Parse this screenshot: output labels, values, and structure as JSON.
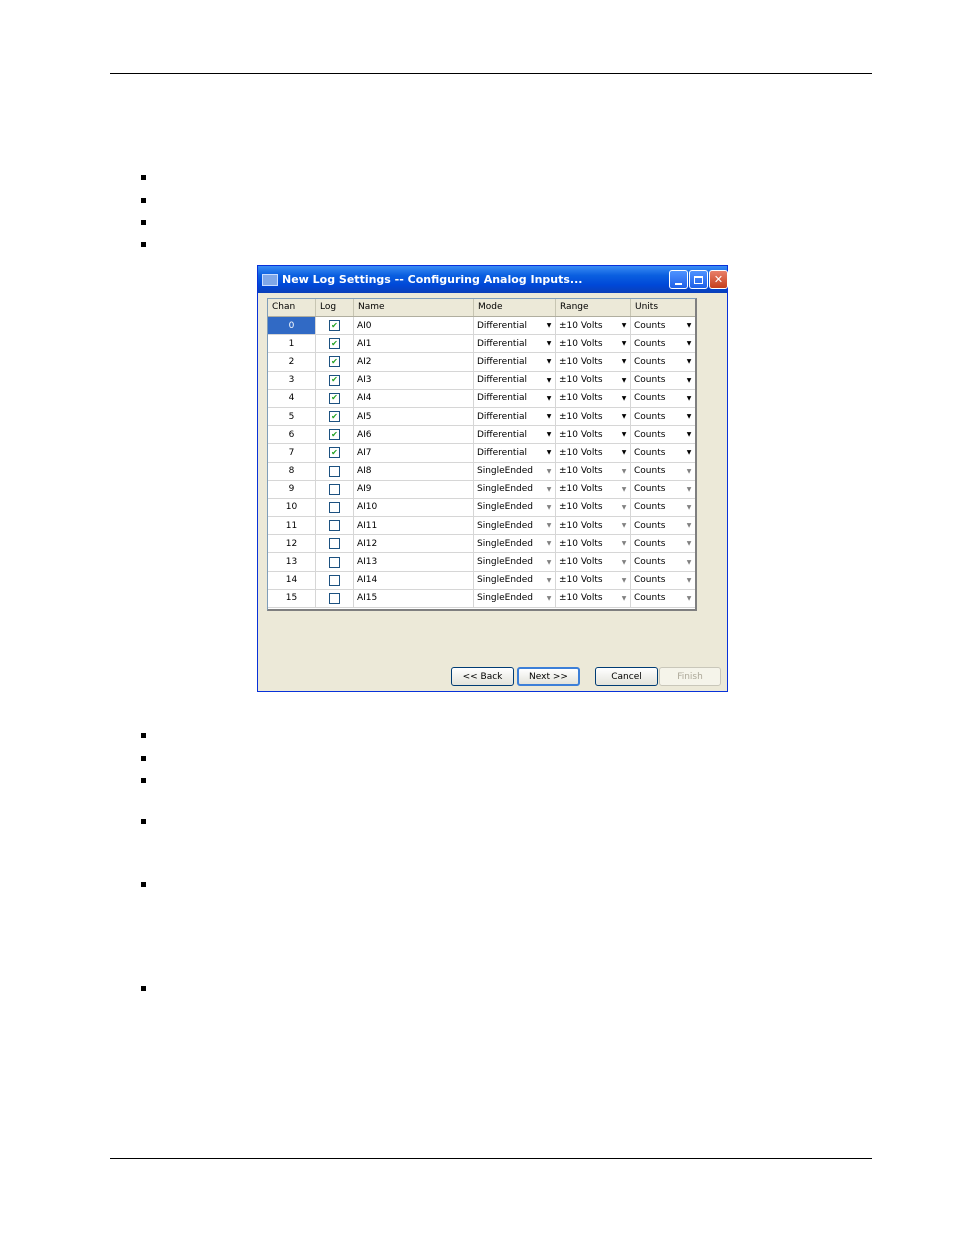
{
  "dialog": {
    "title": "New Log Settings -- Configuring Analog Inputs...",
    "columns": [
      "Chan",
      "Log",
      "Name",
      "Mode",
      "Range",
      "Units"
    ],
    "rows": [
      {
        "chan": "0",
        "log": true,
        "name": "AI0",
        "mode": "Differential",
        "range": "±10 Volts",
        "units": "Counts"
      },
      {
        "chan": "1",
        "log": true,
        "name": "AI1",
        "mode": "Differential",
        "range": "±10 Volts",
        "units": "Counts"
      },
      {
        "chan": "2",
        "log": true,
        "name": "AI2",
        "mode": "Differential",
        "range": "±10 Volts",
        "units": "Counts"
      },
      {
        "chan": "3",
        "log": true,
        "name": "AI3",
        "mode": "Differential",
        "range": "±10 Volts",
        "units": "Counts"
      },
      {
        "chan": "4",
        "log": true,
        "name": "AI4",
        "mode": "Differential",
        "range": "±10 Volts",
        "units": "Counts"
      },
      {
        "chan": "5",
        "log": true,
        "name": "AI5",
        "mode": "Differential",
        "range": "±10 Volts",
        "units": "Counts"
      },
      {
        "chan": "6",
        "log": true,
        "name": "AI6",
        "mode": "Differential",
        "range": "±10 Volts",
        "units": "Counts"
      },
      {
        "chan": "7",
        "log": true,
        "name": "AI7",
        "mode": "Differential",
        "range": "±10 Volts",
        "units": "Counts"
      },
      {
        "chan": "8",
        "log": false,
        "name": "AI8",
        "mode": "SingleEnded",
        "range": "±10 Volts",
        "units": "Counts"
      },
      {
        "chan": "9",
        "log": false,
        "name": "AI9",
        "mode": "SingleEnded",
        "range": "±10 Volts",
        "units": "Counts"
      },
      {
        "chan": "10",
        "log": false,
        "name": "AI10",
        "mode": "SingleEnded",
        "range": "±10 Volts",
        "units": "Counts"
      },
      {
        "chan": "11",
        "log": false,
        "name": "AI11",
        "mode": "SingleEnded",
        "range": "±10 Volts",
        "units": "Counts"
      },
      {
        "chan": "12",
        "log": false,
        "name": "AI12",
        "mode": "SingleEnded",
        "range": "±10 Volts",
        "units": "Counts"
      },
      {
        "chan": "13",
        "log": false,
        "name": "AI13",
        "mode": "SingleEnded",
        "range": "±10 Volts",
        "units": "Counts"
      },
      {
        "chan": "14",
        "log": false,
        "name": "AI14",
        "mode": "SingleEnded",
        "range": "±10 Volts",
        "units": "Counts"
      },
      {
        "chan": "15",
        "log": false,
        "name": "AI15",
        "mode": "SingleEnded",
        "range": "±10 Volts",
        "units": "Counts"
      }
    ],
    "buttons": {
      "back": "<< Back",
      "next": "Next >>",
      "cancel": "Cancel",
      "finish": "Finish"
    }
  },
  "colors": {
    "titlebar": "#0a5fe0",
    "selection": "#316ac5",
    "checkmark": "#21a121",
    "dialog_bg": "#ece9d8"
  }
}
